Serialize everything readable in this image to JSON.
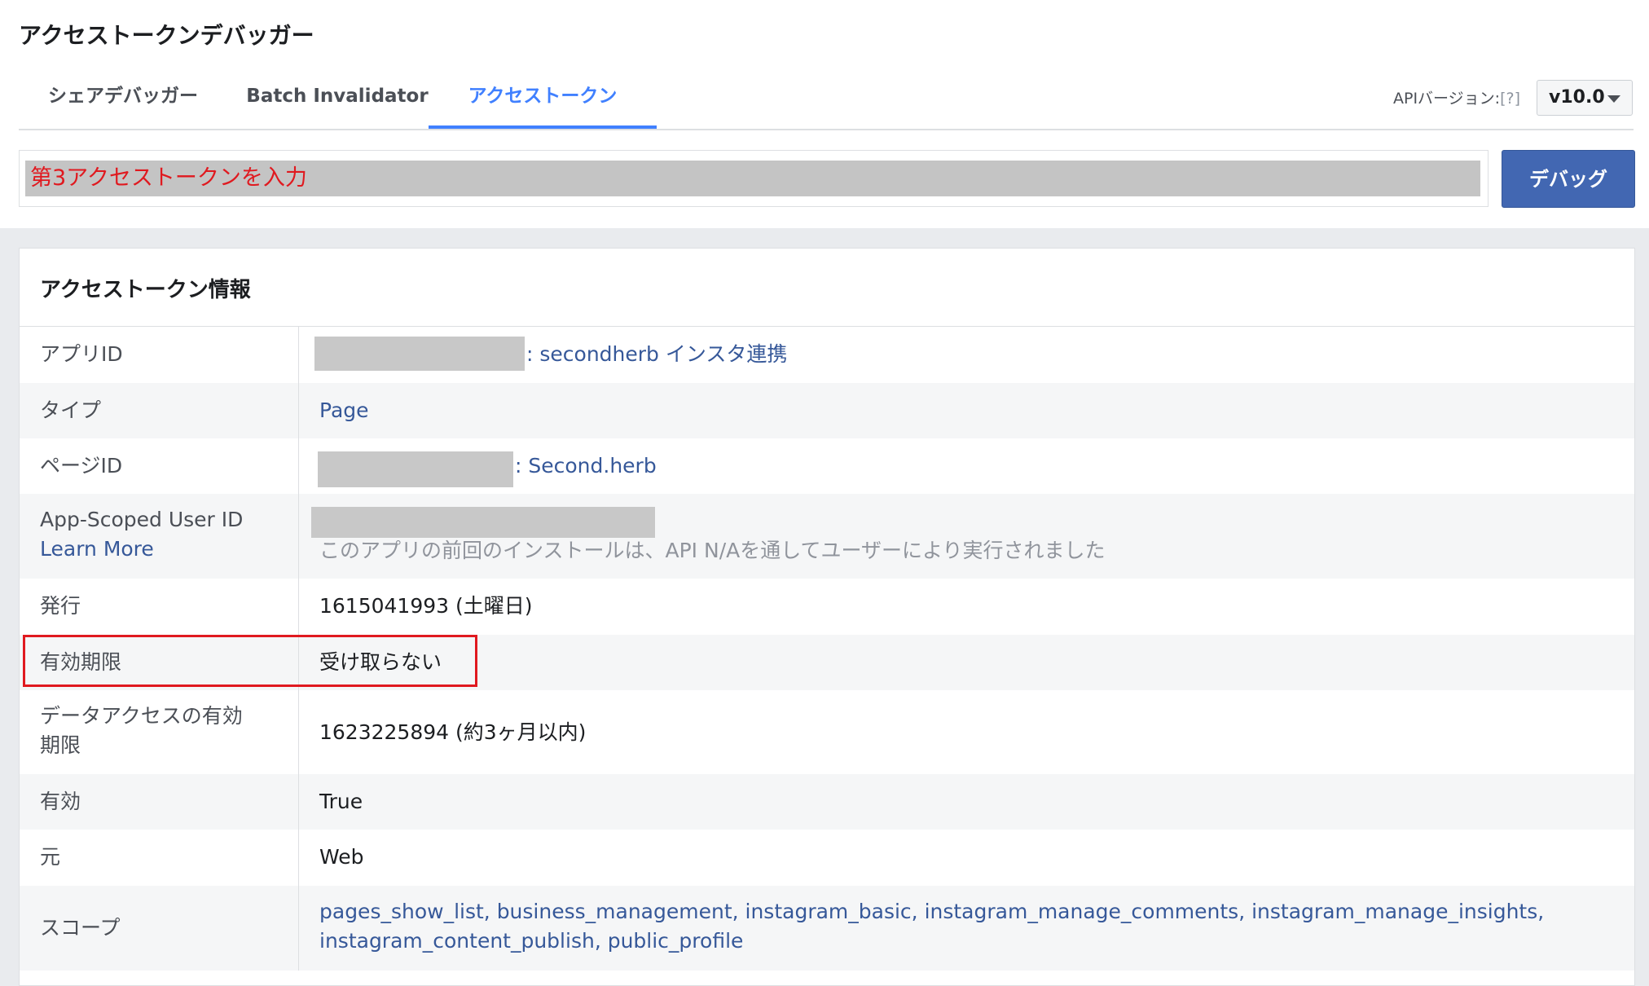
{
  "header": {
    "title": "アクセストークンデバッガー"
  },
  "tabs": [
    {
      "label": "シェアデバッガー"
    },
    {
      "label": "Batch Invalidator"
    },
    {
      "label": "アクセストークン",
      "active": true
    }
  ],
  "api_version": {
    "label": "APIバージョン:",
    "help": "[?]",
    "selected": "v10.0"
  },
  "token_input": {
    "value": "第3アクセストークンを入力"
  },
  "debug_button": {
    "label": "デバッグ"
  },
  "info": {
    "title": "アクセストークン情報",
    "app_id": {
      "label": "アプリID",
      "value": ": secondherb インスタ連携"
    },
    "type": {
      "label": "タイプ",
      "value": "Page"
    },
    "page_id": {
      "label": "ページID",
      "value": ": Second.herb"
    },
    "app_scoped_user_id": {
      "label": "App-Scoped User ID",
      "learn_more": "Learn More",
      "note": "このアプリの前回のインストールは、API N/Aを通してユーザーにより実行されました"
    },
    "issued": {
      "label": "発行",
      "value": "1615041993 (土曜日)"
    },
    "expires": {
      "label": "有効期限",
      "value": "受け取らない"
    },
    "data_access_expires": {
      "label_line1": "データアクセスの有効",
      "label_line2": "期限",
      "value": "1623225894 (約3ヶ月以内)"
    },
    "valid": {
      "label": "有効",
      "value": "True"
    },
    "origin": {
      "label": "元",
      "value": "Web"
    },
    "scopes": {
      "label": "スコープ",
      "line1": "pages_show_list, business_management, instagram_basic, instagram_manage_comments, instagram_manage_insights,",
      "line2": "instagram_content_publish, public_profile"
    }
  },
  "colors": {
    "accent": "#4080ff",
    "button": "#4267b2",
    "link": "#365899",
    "highlight": "#e0191f"
  }
}
